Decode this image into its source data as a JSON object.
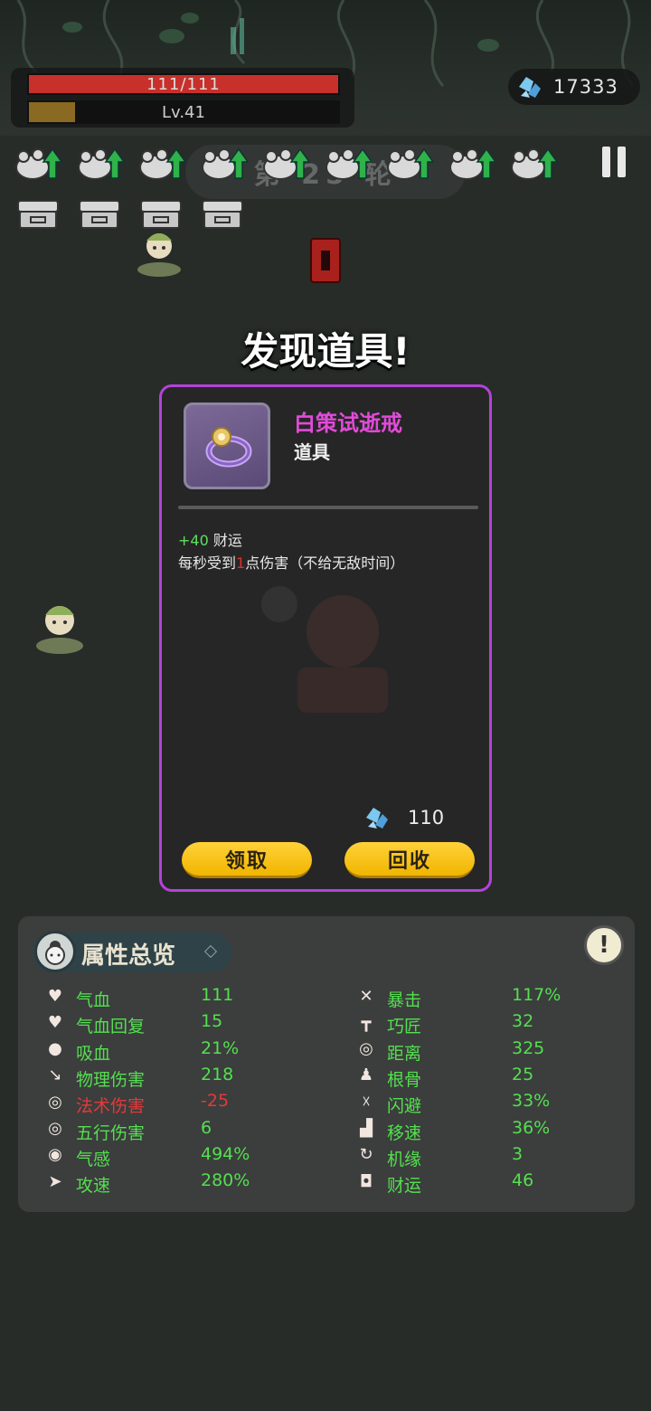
{
  "hud": {
    "hp_text": "111/111",
    "hp_fraction": 1.0,
    "level_text": "Lv.41",
    "xp_fraction": 0.15,
    "currency_value": "17333",
    "wave_text": "第 25 轮"
  },
  "dialog": {
    "title": "发现道具!",
    "item_name": "白策试逝戒",
    "item_type": "道具",
    "effect1_value": "+40",
    "effect1_text": " 财运",
    "effect2_prefix": "每秒受到",
    "effect2_value": "1",
    "effect2_suffix": "点伤害（不给无敌时间）",
    "price_value": "110",
    "claim_label": "领取",
    "recycle_label": "回收"
  },
  "attributes": {
    "title": "属性总览",
    "left": [
      {
        "label": "气血",
        "value": "111",
        "icon": "heart-icon",
        "color": "#55df50"
      },
      {
        "label": "气血回复",
        "value": "15",
        "icon": "heart-regen-icon",
        "color": "#55df50"
      },
      {
        "label": "吸血",
        "value": "21%",
        "icon": "blood-drop-icon",
        "color": "#55df50"
      },
      {
        "label": "物理伤害",
        "value": "218",
        "icon": "sword-icon",
        "color": "#55df50"
      },
      {
        "label": "法术伤害",
        "value": "-25",
        "icon": "spell-swirl-icon",
        "color": "#e23a3a"
      },
      {
        "label": "五行伤害",
        "value": "6",
        "icon": "elements-spiral-icon",
        "color": "#55df50"
      },
      {
        "label": "气感",
        "value": "494%",
        "icon": "qi-sense-icon",
        "color": "#55df50"
      },
      {
        "label": "攻速",
        "value": "280%",
        "icon": "attack-speed-icon",
        "color": "#55df50"
      }
    ],
    "right": [
      {
        "label": "暴击",
        "value": "117%",
        "icon": "crit-icon",
        "color": "#55df50"
      },
      {
        "label": "巧匠",
        "value": "32",
        "icon": "hammer-icon",
        "color": "#55df50"
      },
      {
        "label": "距离",
        "value": "325",
        "icon": "range-target-icon",
        "color": "#55df50"
      },
      {
        "label": "根骨",
        "value": "25",
        "icon": "constitution-icon",
        "color": "#55df50"
      },
      {
        "label": "闪避",
        "value": "33%",
        "icon": "dodge-icon",
        "color": "#55df50"
      },
      {
        "label": "移速",
        "value": "36%",
        "icon": "boot-icon",
        "color": "#55df50"
      },
      {
        "label": "机缘",
        "value": "3",
        "icon": "luck-swirl-icon",
        "color": "#55df50"
      },
      {
        "label": "财运",
        "value": "46",
        "icon": "coin-icon",
        "color": "#55df50"
      }
    ]
  },
  "colors": {
    "card_border": "#b144d6",
    "item_name": "#e24bd8",
    "button": "#f0b500",
    "positive": "#55df50",
    "negative": "#e23a3a"
  }
}
